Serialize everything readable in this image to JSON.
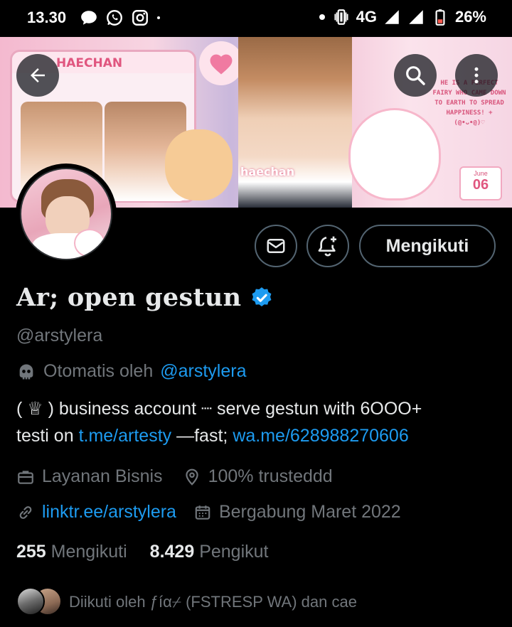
{
  "status_bar": {
    "time": "13.30",
    "network": "4G",
    "battery": "26%",
    "left_icons": [
      "chat-bubble-icon",
      "whatsapp-icon",
      "instagram-icon",
      "dot-icon"
    ],
    "right_icons": [
      "dot-icon",
      "vibrate-icon",
      "signal-icon",
      "signal-icon",
      "battery-icon"
    ]
  },
  "banner": {
    "header_label": "HAECHAN",
    "photo_label": "haechan",
    "quote": "HE IS A PERFECT FAIRY WHO CAME DOWN TO EARTH TO SPREAD HAPPINESS! +(@•ᴗ•@)♡",
    "date_month": "June",
    "date_day": "06"
  },
  "header_actions": {
    "back": "arrow-left-icon",
    "search": "search-icon",
    "more": "more-vertical-icon"
  },
  "profile": {
    "display_name": "Ar; open gestun",
    "verified": true,
    "handle": "@arstylera",
    "automated_prefix": "Otomatis oleh",
    "automated_by": "@arstylera",
    "bio_line1": "( ♕ ) business account ┈ serve gestun with 6OOO+",
    "bio_line2_prefix": "testi on",
    "bio_link1": "t.me/artesty",
    "bio_line2_mid": "—fast;",
    "bio_link2": "wa.me/628988270606",
    "category": "Layanan Bisnis",
    "location": "100% trusteddd",
    "website": "linktr.ee/arstylera",
    "joined": "Bergabung Maret 2022",
    "following_count": "255",
    "following_label": "Mengikuti",
    "followers_count": "8.429",
    "followers_label": "Pengikut",
    "followed_by": "Diikuti oleh ƒíα⌿ (FSTRESP WA) dan cae"
  },
  "buttons": {
    "follow_label": "Mengikuti",
    "message_icon": "mail-icon",
    "notify_icon": "bell-plus-icon"
  },
  "colors": {
    "background": "#000000",
    "text_primary": "#e7e9ea",
    "text_secondary": "#71767b",
    "link": "#1d9bf0",
    "verified_badge": "#1d9bf0",
    "button_border": "#536471"
  }
}
